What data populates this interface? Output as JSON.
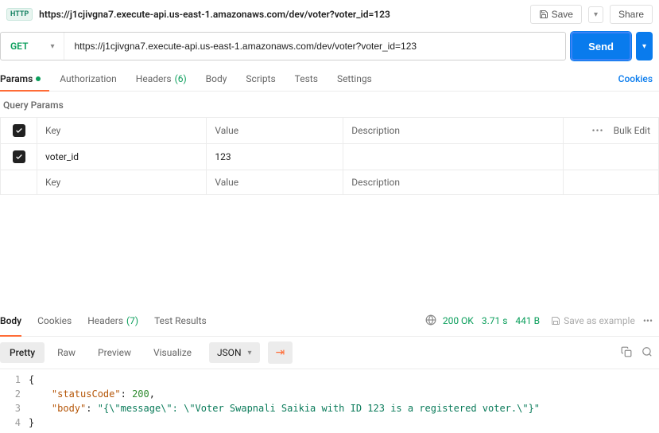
{
  "header": {
    "badge": "HTTP",
    "title": "https://j1cjivgna7.execute-api.us-east-1.amazonaws.com/dev/voter?voter_id=123",
    "save": "Save",
    "share": "Share"
  },
  "request": {
    "method": "GET",
    "url": "https://j1cjivgna7.execute-api.us-east-1.amazonaws.com/dev/voter?voter_id=123",
    "send": "Send"
  },
  "tabs": {
    "params": "Params",
    "auth": "Authorization",
    "headers": "Headers",
    "headers_count": "(6)",
    "body": "Body",
    "scripts": "Scripts",
    "tests": "Tests",
    "settings": "Settings",
    "cookies": "Cookies"
  },
  "query": {
    "title": "Query Params",
    "headers": {
      "key": "Key",
      "value": "Value",
      "desc": "Description",
      "bulk": "Bulk Edit"
    },
    "rows": [
      {
        "key": "voter_id",
        "value": "123",
        "desc": ""
      }
    ],
    "placeholders": {
      "key": "Key",
      "value": "Value",
      "desc": "Description"
    }
  },
  "response": {
    "tabs": {
      "body": "Body",
      "cookies": "Cookies",
      "headers": "Headers",
      "headers_count": "(7)",
      "tests": "Test Results"
    },
    "status_code": "200 OK",
    "time": "3.71 s",
    "size": "441 B",
    "save_example": "Save as example",
    "formatters": {
      "pretty": "Pretty",
      "raw": "Raw",
      "preview": "Preview",
      "visualize": "Visualize",
      "lang": "JSON"
    },
    "payload": {
      "line1": "{",
      "key2": "\"statusCode\"",
      "val2": "200",
      "key3": "\"body\"",
      "val3": "\"{\\\"message\\\": \\\"Voter Swapnali Saikia with ID 123 is a registered voter.\\\"}\"",
      "line4": "}"
    }
  }
}
